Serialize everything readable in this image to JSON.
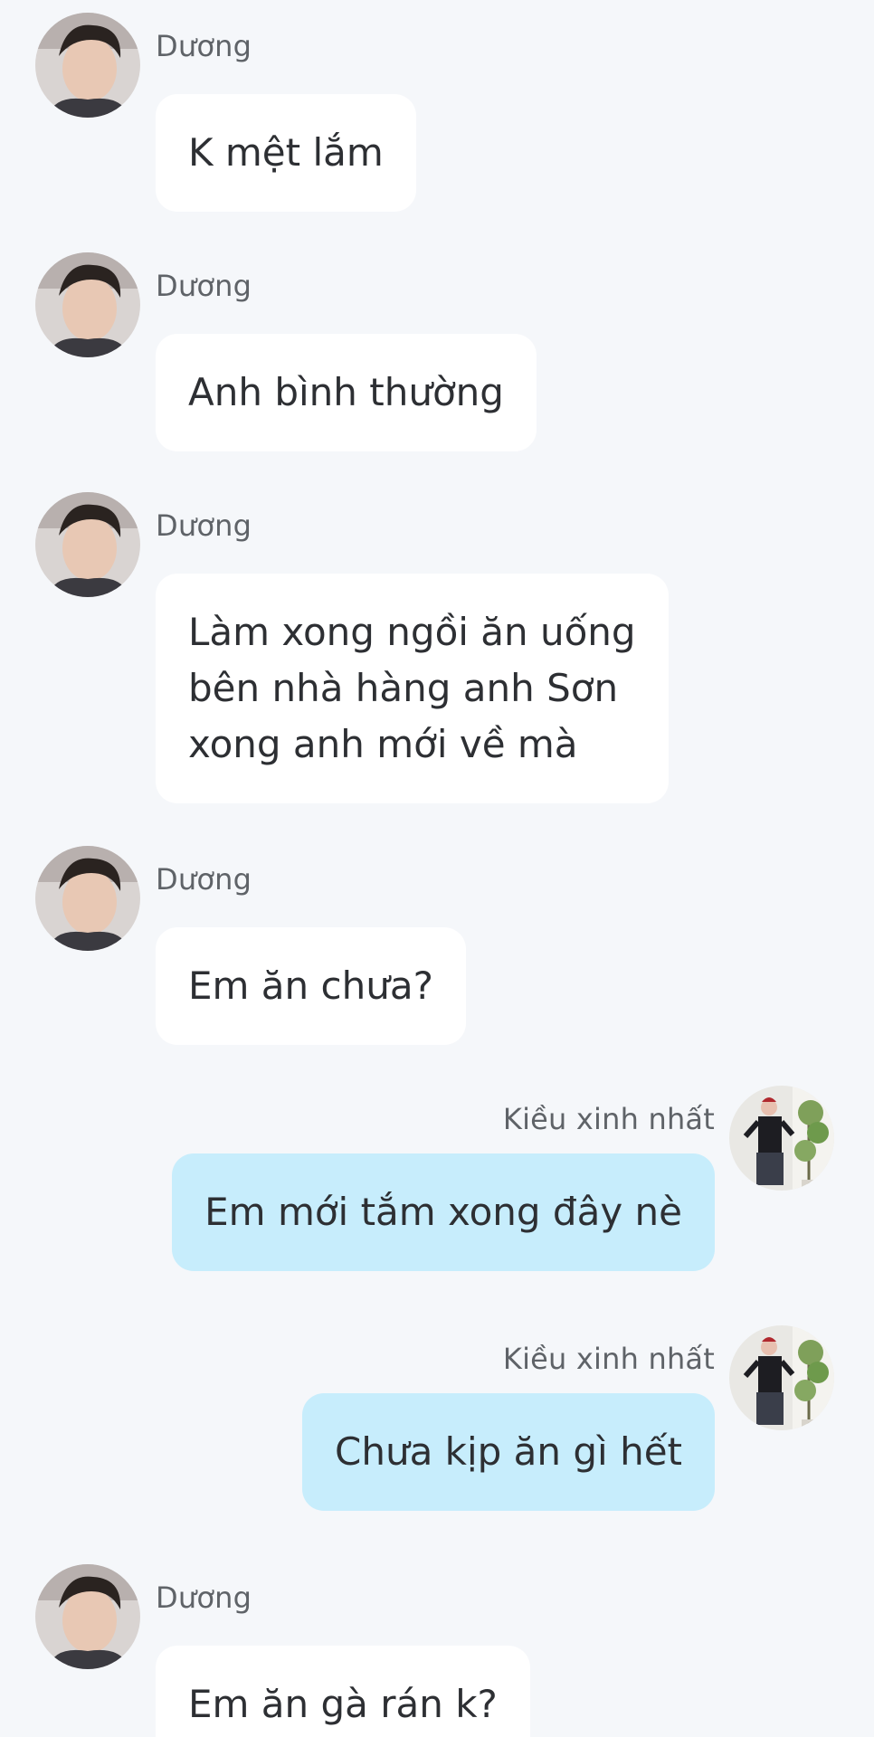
{
  "contacts": {
    "duong": {
      "name": "Dương",
      "avatar_icon": "user-avatar-duong"
    },
    "kieu": {
      "name": "Kiều xinh nhất",
      "avatar_icon": "user-avatar-kieu"
    }
  },
  "colors": {
    "background": "#f5f7fa",
    "incoming_bubble": "#ffffff",
    "outgoing_bubble": "#c7edfc",
    "text": "#2d2f33",
    "sender_text": "#5f6368"
  },
  "messages": [
    {
      "direction": "incoming",
      "sender": "Dương",
      "lines": [
        "K mệt lắm"
      ]
    },
    {
      "direction": "incoming",
      "sender": "Dương",
      "lines": [
        "Anh bình thường"
      ]
    },
    {
      "direction": "incoming",
      "sender": "Dương",
      "lines": [
        "Làm xong ngồi ăn uống",
        "bên nhà hàng anh Sơn",
        "xong anh mới về mà"
      ]
    },
    {
      "direction": "incoming",
      "sender": "Dương",
      "lines": [
        "Em ăn chưa?"
      ]
    },
    {
      "direction": "outgoing",
      "sender": "Kiều xinh nhất",
      "lines": [
        "Em mới tắm xong đây nè"
      ]
    },
    {
      "direction": "outgoing",
      "sender": "Kiều xinh nhất",
      "lines": [
        "Chưa kịp ăn gì hết"
      ]
    },
    {
      "direction": "incoming",
      "sender": "Dương",
      "lines": [
        "Em ăn gà rán k?"
      ]
    }
  ]
}
